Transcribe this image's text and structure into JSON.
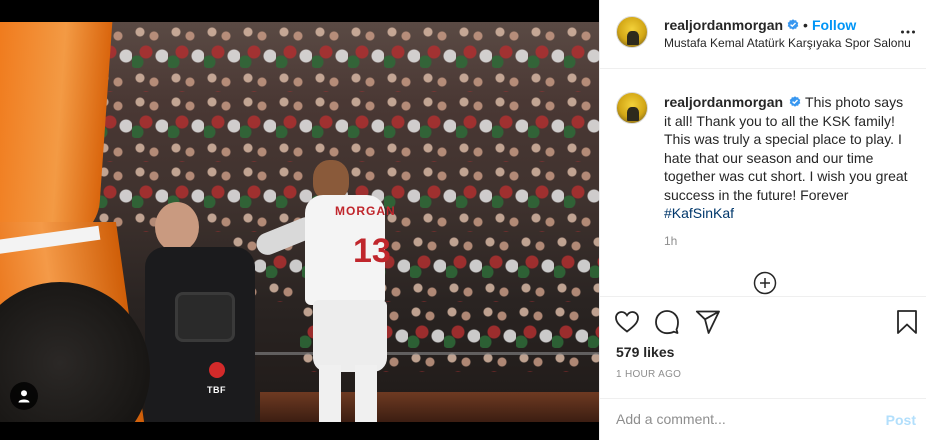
{
  "post": {
    "username": "realjordanmorgan",
    "follow_label": "Follow",
    "separator": "•",
    "location": "Mustafa Kemal Atatürk Karşıyaka Spor Salonu",
    "caption_text": "This photo says it all! Thank you to all the KSK family! This was truly a special place to play. I hate that our season and our time together was cut short. I wish you great success in the future! Forever ",
    "hashtag": "#KafSinKaf",
    "relative_time": "1h",
    "likes": "579 likes",
    "posted_time": "1 HOUR AGO",
    "comment_placeholder": "Add a comment...",
    "post_label": "Post"
  },
  "photo": {
    "jersey_number": "13",
    "jersey_name": "MORGAN",
    "logo_text": "TBF"
  },
  "icons": {
    "verified": "verified-badge-icon",
    "more": "more-options-icon",
    "like": "heart-icon",
    "comment": "comment-bubble-icon",
    "share": "paper-plane-icon",
    "save": "bookmark-icon",
    "load_more": "plus-circle-icon",
    "tagged_user": "user-icon"
  },
  "colors": {
    "link_blue": "#0095f6",
    "post_disabled": "#b2dffc",
    "hashtag": "#00376b",
    "text": "#262626",
    "muted": "#8e8e8e"
  }
}
